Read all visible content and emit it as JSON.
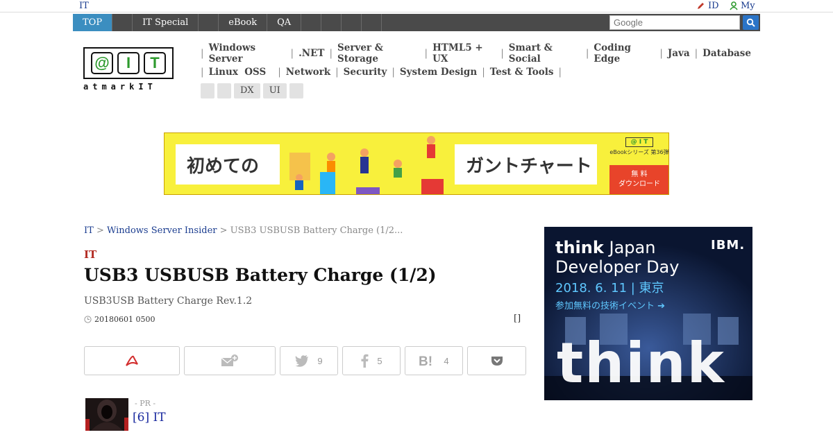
{
  "topbar": {
    "site_label": "IT",
    "id_link": "ID",
    "my_link": "My"
  },
  "nav": {
    "tabs": [
      {
        "label": "TOP",
        "active": true
      },
      {
        "label": ""
      },
      {
        "label": "IT Special"
      },
      {
        "label": ""
      },
      {
        "label": "eBook"
      },
      {
        "label": "QA"
      },
      {
        "label": ""
      },
      {
        "label": ""
      },
      {
        "label": ""
      },
      {
        "label": ""
      }
    ],
    "search_placeholder": "Google"
  },
  "logo": {
    "chars": [
      "@",
      "I",
      "T"
    ],
    "sub": "atmarkIT"
  },
  "categories": {
    "row1": [
      "Windows Server",
      ".NET",
      "Server & Storage",
      "HTML5 + UX",
      "Smart & Social",
      "Coding Edge",
      "Java",
      "Database"
    ],
    "row2": [
      "Linux  OSS",
      "Network",
      "Security",
      "System Design",
      "Test & Tools"
    ],
    "tags": [
      "",
      "",
      "DX",
      "UI",
      ""
    ]
  },
  "banner": {
    "text_left": "初めての",
    "text_right": "ガントチャート",
    "badge_logo": "@ I T",
    "badge_series": "eBookシリーズ 第36弾",
    "cta_line1": "無 料",
    "cta_line2": "ダウンロード"
  },
  "breadcrumb": {
    "root": "IT",
    "sep1": " > ",
    "section": "Windows Server Insider",
    "sep2": " > ",
    "current": "USB3 USBUSB Battery Charge (1/2..."
  },
  "article": {
    "category": "IT",
    "title": "USB3 USBUSB Battery Charge (1/2)",
    "subtitle": "USB3USB Battery Charge Rev.1.2",
    "date": "20180601 0500",
    "bracket": "[]"
  },
  "share": {
    "twitter_count": "9",
    "facebook_count": "5",
    "hatena_count": "4"
  },
  "pr": {
    "label": "- PR -",
    "link": "[6] IT"
  },
  "side_ad": {
    "think": "think",
    "japan": "Japan",
    "line2": "Developer Day",
    "date": "2018. 6. 11 | 東京",
    "cta": "参加無料の技術イベント ➔",
    "brand": "IBM.",
    "big": "think"
  },
  "colors": {
    "nav_bg": "#4a4a4a",
    "nav_active": "#3b8ec0",
    "link": "#1a3c8f",
    "category_red": "#b22a22",
    "banner_yellow": "#f8f03c",
    "cta_red": "#e8442a"
  }
}
